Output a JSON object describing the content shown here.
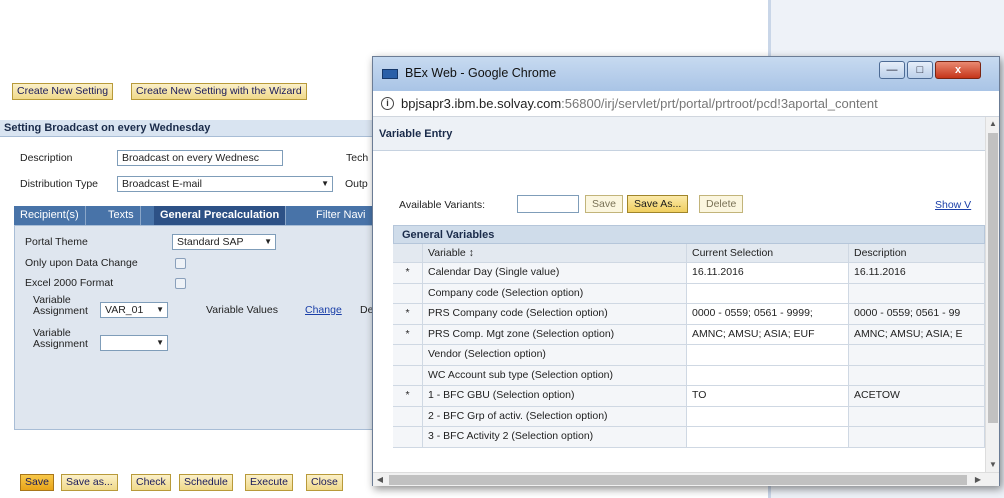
{
  "background_app": {
    "toolbar": {
      "create_new_setting": "Create New Setting",
      "create_with_wizard": "Create New Setting with the Wizard"
    },
    "panel_title": "Setting Broadcast on every Wednesday",
    "description_label": "Description",
    "description_value": "Broadcast on every Wednesc",
    "technical_label_partial": "Tech",
    "distribution_type_label": "Distribution Type",
    "distribution_type_value": "Broadcast E-mail",
    "output_label_partial": "Outp",
    "tabs": [
      "Recipient(s)",
      "Texts",
      "General Precalculation",
      "Filter Navi"
    ],
    "portal_theme_label": "Portal Theme",
    "portal_theme_value": "Standard SAP",
    "only_upon_data_change_label": "Only upon Data Change",
    "excel_2000_format_label": "Excel 2000 Format",
    "variable_assignment_label_1": "Variable",
    "variable_assignment_label_2": "Assignment",
    "variable_assignment_value": "VAR_01",
    "variable_values_label": "Variable Values",
    "change_link": "Change",
    "partial_de": "De",
    "bottom_buttons": [
      "Save",
      "Save as...",
      "Check",
      "Schedule",
      "Execute",
      "Close"
    ]
  },
  "popup": {
    "window_title": "BEx Web - Google Chrome",
    "url_host": "bpjsapr3.ibm.be.solvay.com",
    "url_rest": ":56800/irj/servlet/prt/portal/prtroot/pcd!3aportal_content",
    "page_header": "Variable Entry",
    "available_variants_label": "Available Variants:",
    "buttons": {
      "save": "Save",
      "save_as": "Save As...",
      "delete": "Delete"
    },
    "show_link": "Show V",
    "grid_title": "General Variables",
    "columns": {
      "variable": "Variable ↕",
      "current_selection": "Current Selection",
      "description": "Description"
    },
    "rows": [
      {
        "mandatory": "*",
        "variable": "Calendar Day (Single value)",
        "selection": "16.11.2016",
        "description": "16.11.2016"
      },
      {
        "mandatory": "",
        "variable": "Company code (Selection option)",
        "selection": "",
        "description": ""
      },
      {
        "mandatory": "*",
        "variable": "PRS Company code (Selection option)",
        "selection": "0000 - 0559; 0561 - 9999;",
        "description": "0000 - 0559; 0561 - 99"
      },
      {
        "mandatory": "*",
        "variable": "PRS Comp. Mgt zone (Selection option)",
        "selection": "AMNC; AMSU; ASIA; EUF",
        "description": "AMNC; AMSU; ASIA; E"
      },
      {
        "mandatory": "",
        "variable": "Vendor (Selection option)",
        "selection": "",
        "description": ""
      },
      {
        "mandatory": "",
        "variable": "WC Account sub type (Selection option)",
        "selection": "",
        "description": ""
      },
      {
        "mandatory": "*",
        "variable": "1 - BFC GBU (Selection option)",
        "selection": "TO",
        "description": "ACETOW"
      },
      {
        "mandatory": "",
        "variable": "2 - BFC Grp of activ. (Selection option)",
        "selection": "",
        "description": ""
      },
      {
        "mandatory": "",
        "variable": "3 - BFC Activity 2 (Selection option)",
        "selection": "",
        "description": ""
      }
    ],
    "window_buttons": {
      "minimize": "—",
      "maximize": "□",
      "close": "x"
    }
  }
}
